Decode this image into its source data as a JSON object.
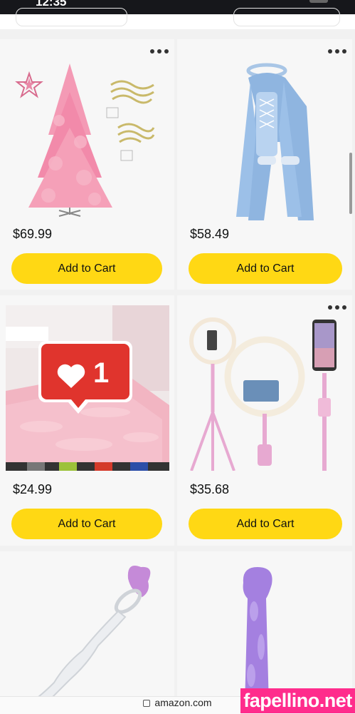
{
  "status_bar": {
    "time": "12:35"
  },
  "browser": {
    "domain": "amazon.com"
  },
  "products": [
    {
      "price": "$69.99",
      "button": "Add to Cart",
      "image": "pink-christmas-tree-image"
    },
    {
      "price": "$58.49",
      "button": "Add to Cart",
      "image": "blue-costume-image"
    },
    {
      "price": "$24.99",
      "button": "Add to Cart",
      "image": "pink-fluffy-rug-image"
    },
    {
      "price": "$35.68",
      "button": "Add to Cart",
      "image": "ring-light-tripod-image"
    },
    {
      "image": "glass-wand-image"
    },
    {
      "image": "purple-toy-image"
    }
  ],
  "notification": {
    "count": "1",
    "icon": "heart-icon",
    "color": "#e0342d"
  },
  "watermark": {
    "text": "fapellino.net",
    "color": "#ff2c8c"
  },
  "colors": {
    "button": "#ffd814",
    "card": "#f7f7f7",
    "background": "#f1f1f1"
  }
}
